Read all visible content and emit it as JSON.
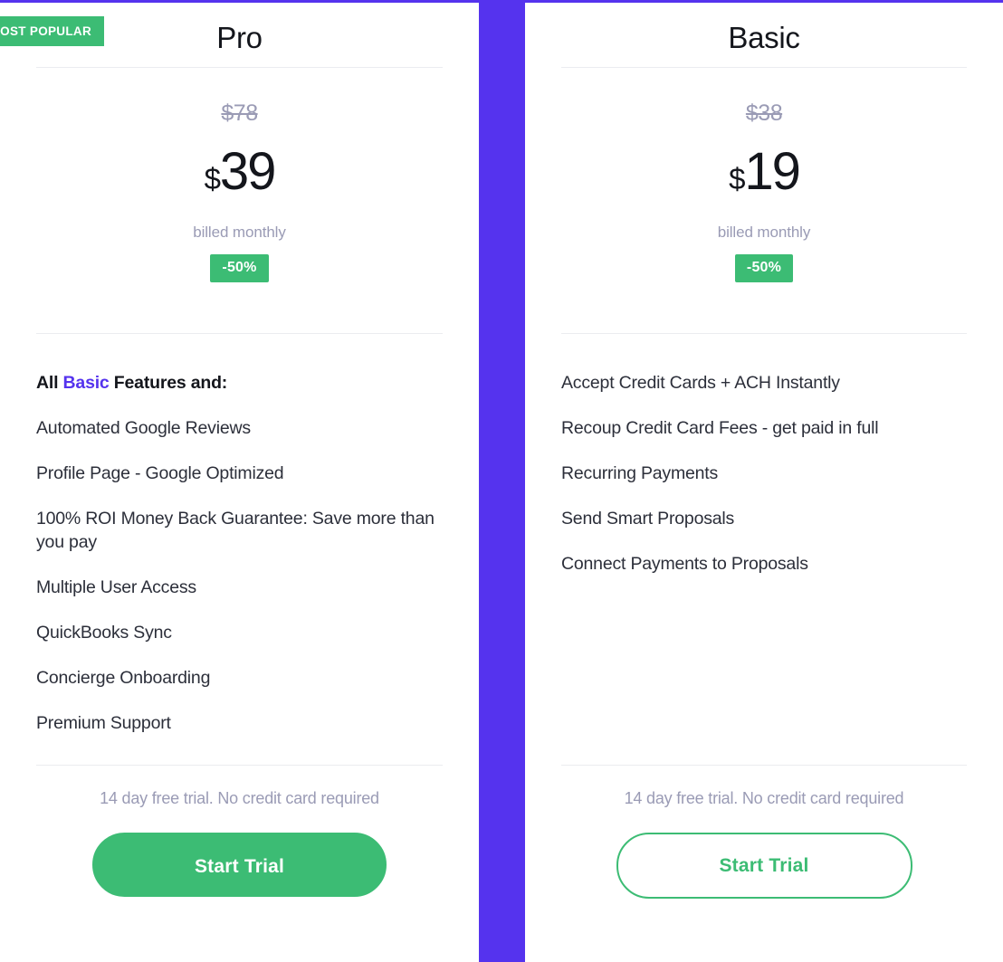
{
  "theme": {
    "accent_purple": "#5533EE",
    "accent_green": "#3CBC74",
    "text_dark": "#14161C",
    "text_muted": "#9A9BB5",
    "divider": "#EBECF0"
  },
  "plans": [
    {
      "id": "pro",
      "badge": "MOST POPULAR",
      "title": "Pro",
      "price_old": "$78",
      "price_currency": "$",
      "price_amount": "39",
      "price_period": "billed monthly",
      "discount": "-50%",
      "features_heading_prefix": "All ",
      "features_heading_accent": "Basic",
      "features_heading_suffix": " Features and:",
      "features": [
        "Automated Google Reviews",
        "Profile Page - Google Optimized",
        "100% ROI Money Back Guarantee: Save more than you pay",
        "Multiple User Access",
        "QuickBooks Sync",
        "Concierge Onboarding",
        "Premium Support"
      ],
      "trial_note": "14 day free trial. No credit card required",
      "cta_label": "Start Trial"
    },
    {
      "id": "basic",
      "title": "Basic",
      "price_old": "$38",
      "price_currency": "$",
      "price_amount": "19",
      "price_period": "billed monthly",
      "discount": "-50%",
      "features": [
        "Accept Credit Cards + ACH Instantly",
        "Recoup Credit Card Fees - get paid in full",
        "Recurring Payments",
        "Send Smart Proposals",
        "Connect Payments to Proposals"
      ],
      "trial_note": "14 day free trial. No credit card required",
      "cta_label": "Start Trial"
    }
  ]
}
